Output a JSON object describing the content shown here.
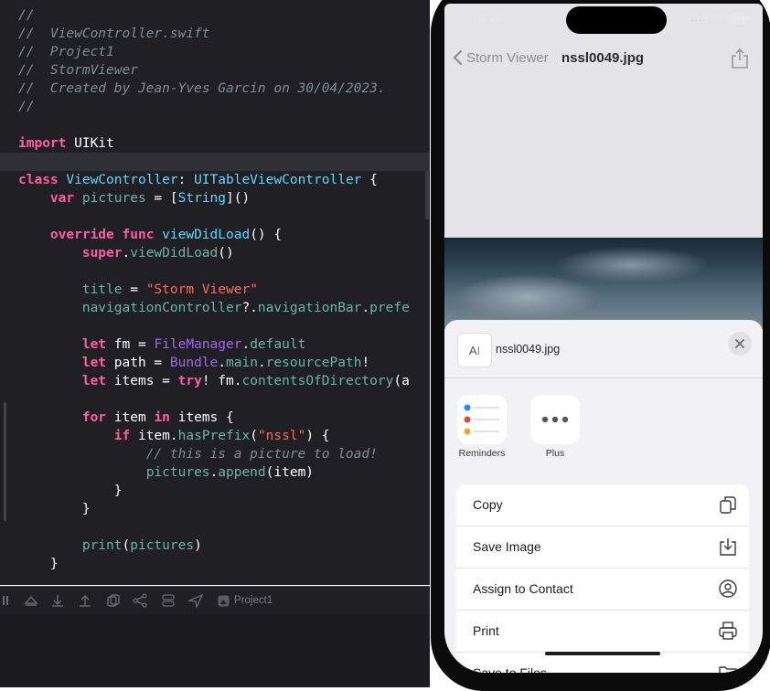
{
  "editor": {
    "lines": [
      [
        [
          "comment",
          "//"
        ]
      ],
      [
        [
          "comment",
          "//  ViewController.swift"
        ]
      ],
      [
        [
          "comment",
          "//  Project1"
        ]
      ],
      [
        [
          "comment",
          "//  StormViewer"
        ]
      ],
      [
        [
          "comment",
          "//  Created by Jean-Yves Garcin on 30/04/2023."
        ]
      ],
      [
        [
          "comment",
          "//"
        ]
      ],
      [],
      [
        [
          "kw",
          "import"
        ],
        [
          "plain",
          " UIKit"
        ]
      ],
      [],
      [
        [
          "kw",
          "class"
        ],
        [
          "plain",
          " "
        ],
        [
          "type",
          "ViewController"
        ],
        [
          "plain",
          ": "
        ],
        [
          "type",
          "UITableViewController"
        ],
        [
          "plain",
          " {"
        ]
      ],
      [
        [
          "plain",
          "    "
        ],
        [
          "kw",
          "var"
        ],
        [
          "plain",
          " "
        ],
        [
          "prop",
          "pictures"
        ],
        [
          "plain",
          " = ["
        ],
        [
          "type",
          "String"
        ],
        [
          "plain",
          "]()"
        ]
      ],
      [],
      [
        [
          "plain",
          "    "
        ],
        [
          "kw",
          "override"
        ],
        [
          "plain",
          " "
        ],
        [
          "kw",
          "func"
        ],
        [
          "plain",
          " "
        ],
        [
          "type",
          "viewDidLoad"
        ],
        [
          "plain",
          "() {"
        ]
      ],
      [
        [
          "plain",
          "        "
        ],
        [
          "kw",
          "super"
        ],
        [
          "plain",
          "."
        ],
        [
          "fn",
          "viewDidLoad"
        ],
        [
          "plain",
          "()"
        ]
      ],
      [],
      [
        [
          "plain",
          "        "
        ],
        [
          "fn",
          "title"
        ],
        [
          "plain",
          " = "
        ],
        [
          "str",
          "\"Storm Viewer\""
        ]
      ],
      [
        [
          "plain",
          "        "
        ],
        [
          "fn",
          "navigationController"
        ],
        [
          "plain",
          "?."
        ],
        [
          "fn",
          "navigationBar"
        ],
        [
          "plain",
          "."
        ],
        [
          "fn",
          "prefe"
        ]
      ],
      [],
      [
        [
          "plain",
          "        "
        ],
        [
          "kw",
          "let"
        ],
        [
          "plain",
          " fm = "
        ],
        [
          "lib",
          "FileManager"
        ],
        [
          "plain",
          "."
        ],
        [
          "fn",
          "default"
        ]
      ],
      [
        [
          "plain",
          "        "
        ],
        [
          "kw",
          "let"
        ],
        [
          "plain",
          " path = "
        ],
        [
          "lib",
          "Bundle"
        ],
        [
          "plain",
          "."
        ],
        [
          "fn",
          "main"
        ],
        [
          "plain",
          "."
        ],
        [
          "fn",
          "resourcePath"
        ],
        [
          "plain",
          "!"
        ]
      ],
      [
        [
          "plain",
          "        "
        ],
        [
          "kw",
          "let"
        ],
        [
          "plain",
          " items = "
        ],
        [
          "kw",
          "try"
        ],
        [
          "plain",
          "! fm."
        ],
        [
          "fn",
          "contentsOfDirectory"
        ],
        [
          "plain",
          "(a"
        ]
      ],
      [],
      [
        [
          "plain",
          "        "
        ],
        [
          "kw",
          "for"
        ],
        [
          "plain",
          " item "
        ],
        [
          "kw",
          "in"
        ],
        [
          "plain",
          " items {"
        ]
      ],
      [
        [
          "plain",
          "            "
        ],
        [
          "kw",
          "if"
        ],
        [
          "plain",
          " item."
        ],
        [
          "fn",
          "hasPrefix"
        ],
        [
          "plain",
          "("
        ],
        [
          "str",
          "\"nssl\""
        ],
        [
          "plain",
          ") {"
        ]
      ],
      [
        [
          "plain",
          "                "
        ],
        [
          "comment",
          "// this is a picture to load!"
        ]
      ],
      [
        [
          "plain",
          "                "
        ],
        [
          "prop",
          "pictures"
        ],
        [
          "plain",
          "."
        ],
        [
          "fn",
          "append"
        ],
        [
          "plain",
          "(item)"
        ]
      ],
      [
        [
          "plain",
          "            }"
        ]
      ],
      [
        [
          "plain",
          "        }"
        ]
      ],
      [],
      [
        [
          "plain",
          "        "
        ],
        [
          "fn",
          "print"
        ],
        [
          "plain",
          "("
        ],
        [
          "prop",
          "pictures"
        ],
        [
          "plain",
          ")"
        ]
      ],
      [
        [
          "plain",
          "    }"
        ]
      ]
    ],
    "highlighted_line": 8
  },
  "debug_bar": {
    "target_label": "Project1"
  },
  "simulator": {
    "status": {
      "time": "9:49",
      "dots": "...."
    },
    "nav": {
      "back_label": "Storm Viewer",
      "title": "nssl0049.jpg"
    },
    "share_sheet": {
      "file_name": "nssl0049.jpg",
      "file_thumb_glyph": "A",
      "apps": [
        {
          "label": "Reminders",
          "icon": "reminders-icon"
        },
        {
          "label": "Plus",
          "icon": "more-icon"
        }
      ],
      "actions": [
        {
          "label": "Copy",
          "icon": "copy-icon"
        },
        {
          "label": "Save Image",
          "icon": "save-image-icon"
        },
        {
          "label": "Assign to Contact",
          "icon": "contact-icon"
        },
        {
          "label": "Print",
          "icon": "printer-icon"
        },
        {
          "label": "Save to Files",
          "icon": "folder-icon"
        }
      ]
    }
  }
}
